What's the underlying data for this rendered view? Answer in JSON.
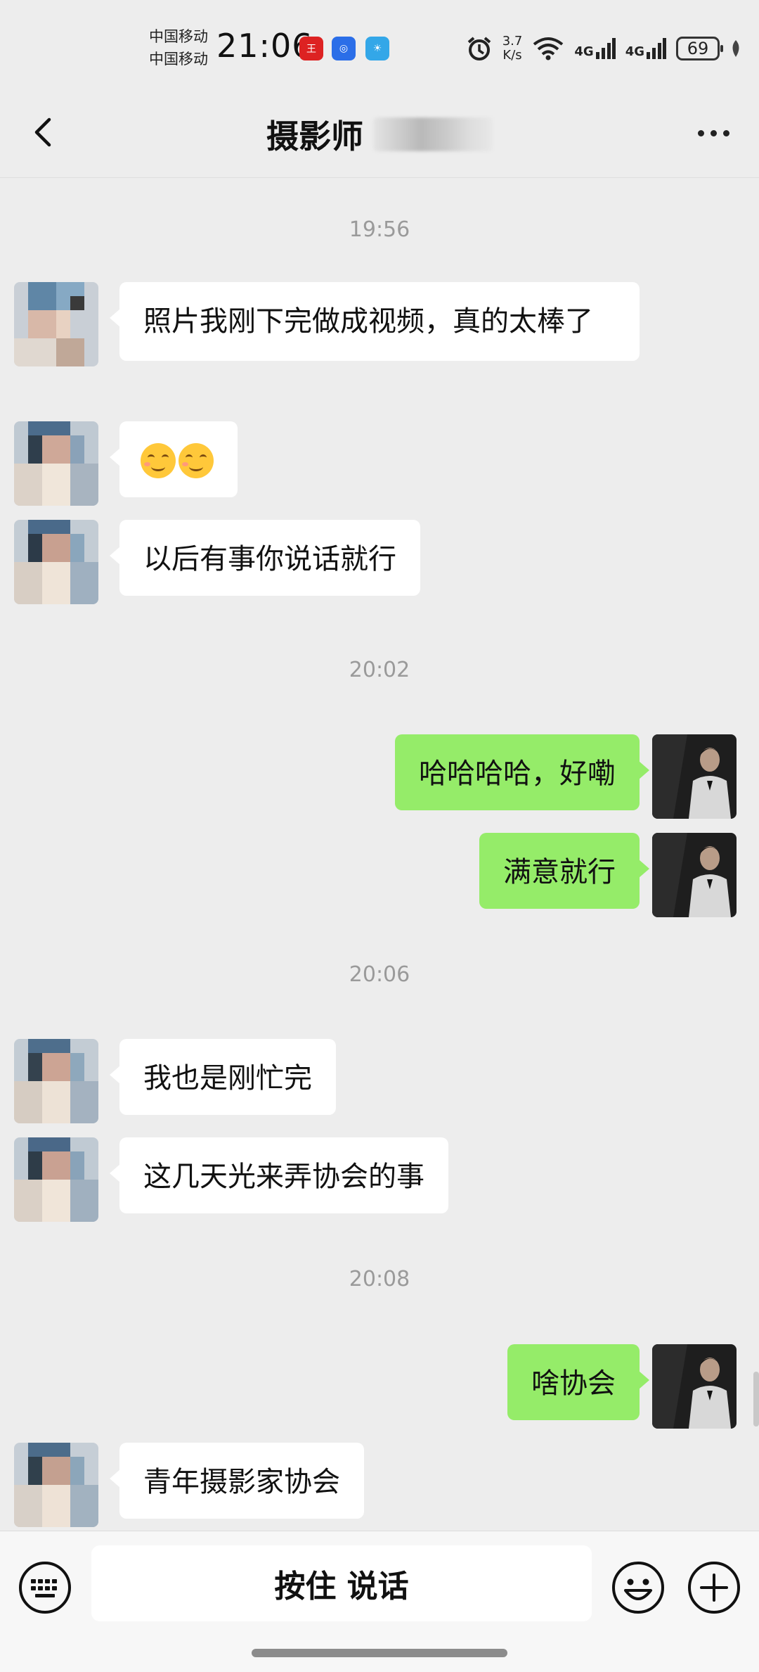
{
  "status_bar": {
    "carrier_1": "中国移动",
    "carrier_2": "中国移动",
    "time": "21:06",
    "net_speed_value": "3.7",
    "net_speed_unit": "K/s",
    "signal_1": "4G",
    "signal_2": "4G",
    "battery": "69"
  },
  "header": {
    "title": "摄影师"
  },
  "chat": {
    "timestamps": [
      "19:56",
      "20:02",
      "20:06",
      "20:08"
    ],
    "messages": [
      {
        "from": "left",
        "text": "照片我刚下完做成视频，真的太棒了"
      },
      {
        "from": "left",
        "text": ""
      },
      {
        "from": "left",
        "text": "以后有事你说话就行"
      },
      {
        "from": "right",
        "text": "哈哈哈哈，好嘞"
      },
      {
        "from": "right",
        "text": "满意就行"
      },
      {
        "from": "left",
        "text": "我也是刚忙完"
      },
      {
        "from": "left",
        "text": "这几天光来弄协会的事"
      },
      {
        "from": "right",
        "text": "啥协会"
      },
      {
        "from": "left",
        "text": "青年摄影家协会"
      }
    ]
  },
  "input_bar": {
    "talk_label": "按住 说话"
  }
}
